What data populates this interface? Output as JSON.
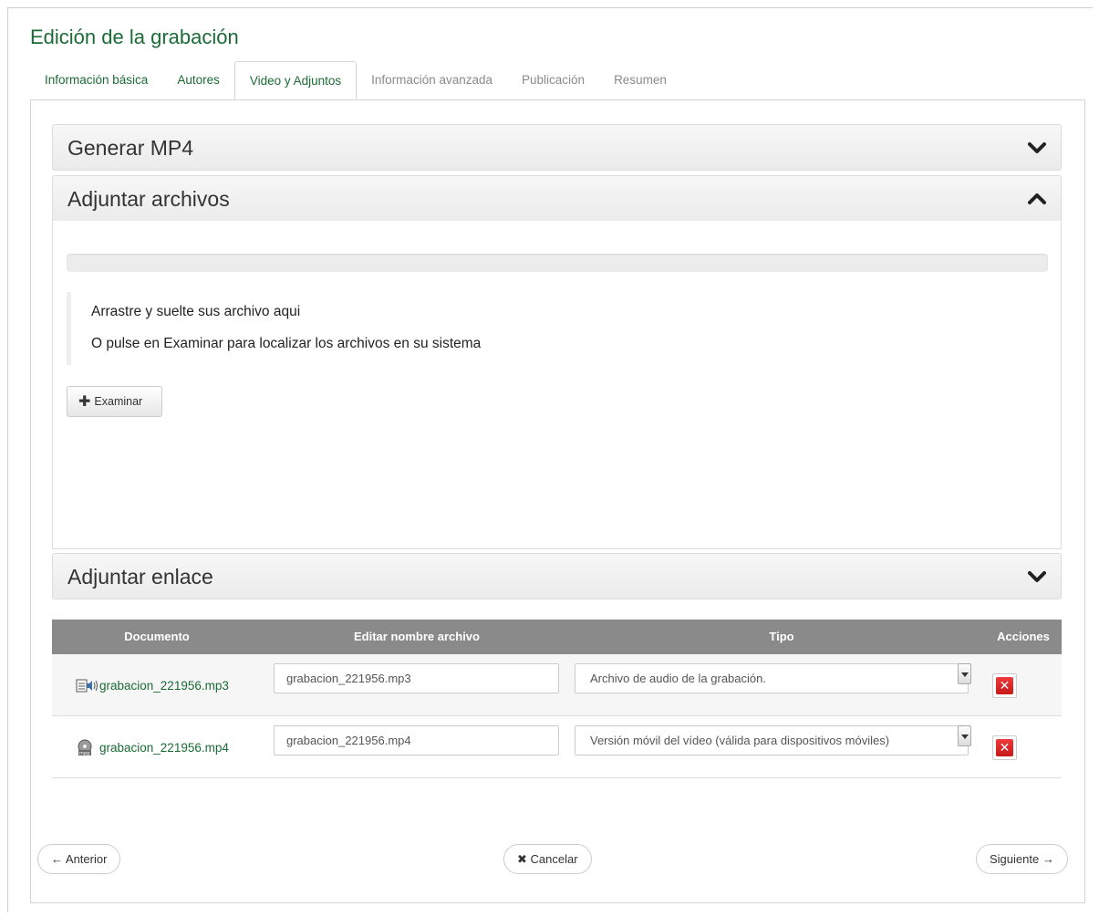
{
  "page": {
    "title": "Edición de la grabación"
  },
  "tabs": [
    {
      "label": "Información básica"
    },
    {
      "label": "Autores"
    },
    {
      "label": "Video y Adjuntos"
    },
    {
      "label": "Información avanzada"
    },
    {
      "label": "Publicación"
    },
    {
      "label": "Resumen"
    }
  ],
  "accordion": {
    "generar": {
      "title": "Generar MP4",
      "icon": "chevron-down-icon"
    },
    "adjuntar_archivos": {
      "title": "Adjuntar archivos",
      "icon": "chevron-up-icon",
      "drop_line1": "Arrastre y suelte sus archivo aqui",
      "drop_line2": "O pulse en Examinar para localizar los archivos en su sistema",
      "browse_label": "Examinar",
      "browse_icon": "plus-icon"
    },
    "adjuntar_enlace": {
      "title": "Adjuntar enlace",
      "icon": "chevron-down-icon"
    }
  },
  "table": {
    "headers": [
      "Documento",
      "Editar nombre archivo",
      "Tipo",
      "Acciones"
    ],
    "rows": [
      {
        "icon": "audio-file-icon",
        "document": "grabacion_221956.mp3",
        "name_value": "grabacion_221956.mp3",
        "type": "Archivo de audio de la grabación."
      },
      {
        "icon": "video-file-icon",
        "document": "grabacion_221956.mp4",
        "name_value": "grabacion_221956.mp4",
        "type": "Versión móvil del vídeo (válida para dispositivos móviles)"
      }
    ]
  },
  "footer": {
    "prev": "← Anterior",
    "cancel": "Cancelar",
    "next": "Siguiente →"
  },
  "colors": {
    "accent_green": "#1b6b36",
    "table_header": "#8a8a8a",
    "delete_red": "#d92626"
  }
}
